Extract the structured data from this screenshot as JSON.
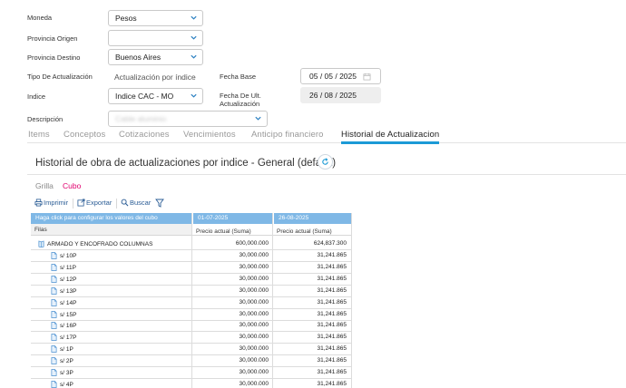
{
  "form": {
    "moneda": {
      "label": "Moneda",
      "value": "Pesos"
    },
    "provincia_origen": {
      "label": "Provincia Origen",
      "value": ""
    },
    "provincia_destino": {
      "label": "Provincia Destino",
      "value": "Buenos Aires"
    },
    "tipo_actualizacion": {
      "label": "Tipo De Actualización",
      "value": "Actualización por índice"
    },
    "indice": {
      "label": "Indice",
      "value": "Indice CAC - MO"
    },
    "descripcion": {
      "label": "Descripción",
      "value": "Cable aluminio"
    },
    "fecha_base": {
      "label": "Fecha Base",
      "value": "05 / 05 / 2025"
    },
    "fecha_ult": {
      "label_line1": "Fecha De Ult.",
      "label_line2": "Actualización",
      "value": "26 / 08 / 2025"
    }
  },
  "tabs": [
    {
      "label": "Items",
      "active": false
    },
    {
      "label": "Conceptos",
      "active": false
    },
    {
      "label": "Cotizaciones",
      "active": false
    },
    {
      "label": "Vencimientos",
      "active": false
    },
    {
      "label": "Anticipo financiero",
      "active": false
    },
    {
      "label": "Historial de Actualizacion",
      "active": true
    }
  ],
  "section": {
    "title": "Historial de obra de actualizaciones por indice - General (default)",
    "refresh_icon": "refresh-icon"
  },
  "view_tabs": {
    "grid": "Grilla",
    "cube": "Cubo"
  },
  "toolbar": {
    "print": "Imprimir",
    "export": "Exportar",
    "search": "Buscar",
    "filter_icon": "filter-icon"
  },
  "colors": {
    "accent": "#1c9ad6",
    "header_blue": "#7fb8e6",
    "cube_pink": "#e0006e",
    "link_blue": "#2a5c95"
  },
  "pivot": {
    "config_hint": "Haga click para configurar los valores del cubo",
    "rows_label": "Filas",
    "columns": [
      {
        "date": "01-07-2025",
        "measure": "Precio actual (Suma)"
      },
      {
        "date": "26-08-2025",
        "measure": "Precio actual (Suma)"
      }
    ],
    "group": {
      "label": "ARMADO Y ENCOFRADO COLUMNAS",
      "values": [
        "600,000.000",
        "624,837.300"
      ]
    },
    "rows": [
      {
        "label": "s/ 10P",
        "values": [
          "30,000.000",
          "31,241.865"
        ]
      },
      {
        "label": "s/ 11P",
        "values": [
          "30,000.000",
          "31,241.865"
        ]
      },
      {
        "label": "s/ 12P",
        "values": [
          "30,000.000",
          "31,241.865"
        ]
      },
      {
        "label": "s/ 13P",
        "values": [
          "30,000.000",
          "31,241.865"
        ]
      },
      {
        "label": "s/ 14P",
        "values": [
          "30,000.000",
          "31,241.865"
        ]
      },
      {
        "label": "s/ 15P",
        "values": [
          "30,000.000",
          "31,241.865"
        ]
      },
      {
        "label": "s/ 16P",
        "values": [
          "30,000.000",
          "31,241.865"
        ]
      },
      {
        "label": "s/ 17P",
        "values": [
          "30,000.000",
          "31,241.865"
        ]
      },
      {
        "label": "s/ 1P",
        "values": [
          "30,000.000",
          "31,241.865"
        ]
      },
      {
        "label": "s/ 2P",
        "values": [
          "30,000.000",
          "31,241.865"
        ]
      },
      {
        "label": "s/ 3P",
        "values": [
          "30,000.000",
          "31,241.865"
        ]
      },
      {
        "label": "s/ 4P",
        "values": [
          "30,000.000",
          "31,241.865"
        ]
      }
    ]
  }
}
